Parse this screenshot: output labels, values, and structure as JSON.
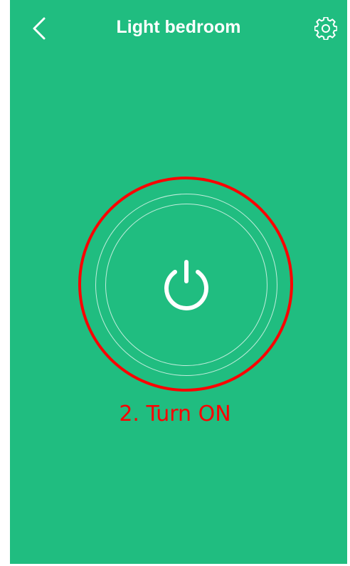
{
  "header": {
    "title": "Light bedroom",
    "back_icon": "chevron-left-icon",
    "settings_icon": "gear-icon"
  },
  "main": {
    "power_icon": "power-icon"
  },
  "annotation": {
    "label": "2. Turn ON"
  },
  "colors": {
    "background": "#20bd80",
    "foreground": "#ffffff",
    "annotation": "#ff0000"
  }
}
